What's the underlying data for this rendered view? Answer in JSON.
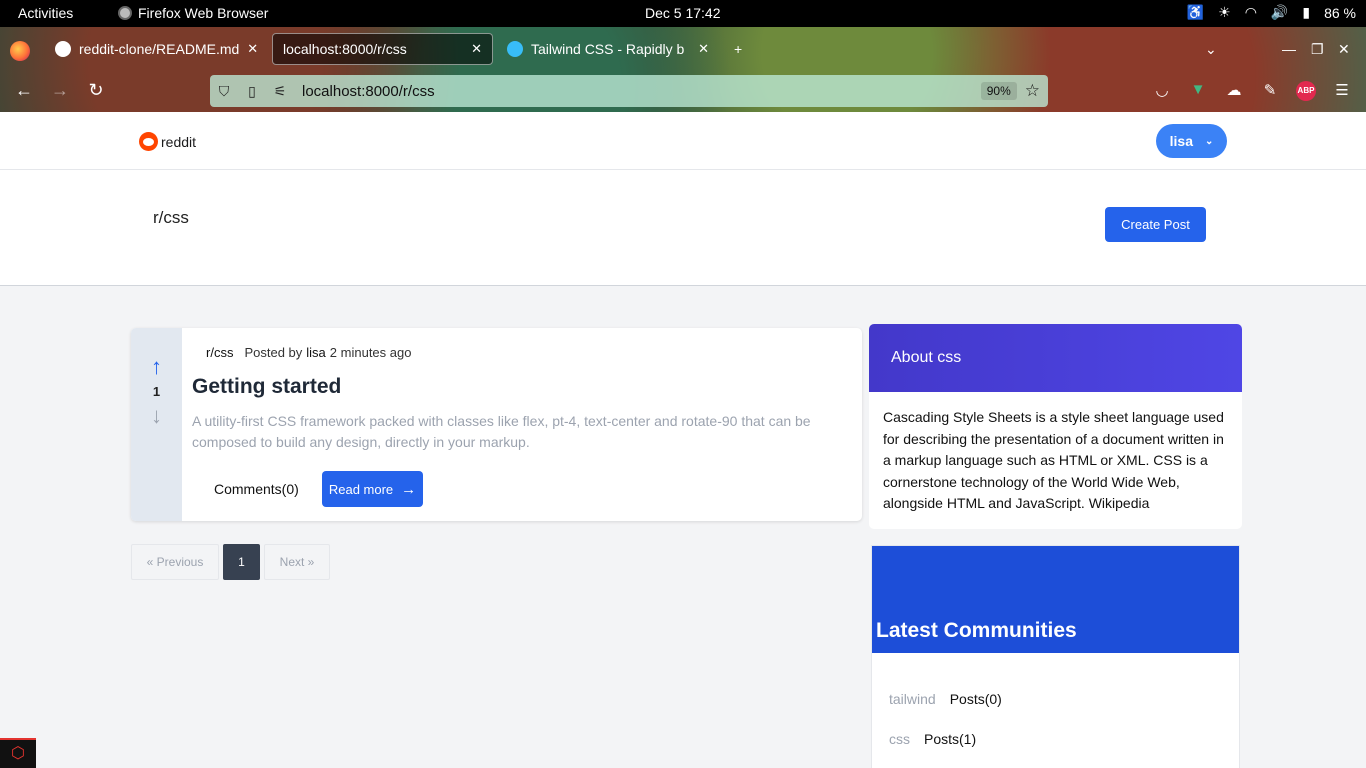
{
  "system": {
    "activities": "Activities",
    "app_name": "Firefox Web Browser",
    "clock": "Dec 5  17:42",
    "battery": "86 %"
  },
  "browser": {
    "tabs": [
      {
        "title": "reddit-clone/README.md",
        "active": false
      },
      {
        "title": "localhost:8000/r/css",
        "active": true
      },
      {
        "title": "Tailwind CSS - Rapidly b",
        "active": false
      }
    ],
    "url": "localhost:8000/r/css",
    "zoom": "90%"
  },
  "site": {
    "logo_text": "reddit",
    "user_name": "lisa"
  },
  "subreddit": {
    "title": "r/css",
    "create_post_label": "Create Post"
  },
  "post": {
    "votes": "1",
    "subreddit": "r/css",
    "posted_by": "Posted by",
    "author": "lisa",
    "time": "2 minutes ago",
    "title": "Getting started",
    "body": "A utility-first CSS framework packed with classes like flex, pt-4, text-center and rotate-90 that can be composed to build any design, directly in your markup.",
    "comments_label": "Comments(0)",
    "read_more_label": "Read more"
  },
  "pagination": {
    "prev": "« Previous",
    "current": "1",
    "next": "Next »"
  },
  "about": {
    "heading": "About css",
    "text": "Cascading Style Sheets is a style sheet language used for describing the presentation of a document written in a markup language such as HTML or XML. CSS is a cornerstone technology of the World Wide Web, alongside HTML and JavaScript. Wikipedia"
  },
  "latest": {
    "heading": "Latest Communities",
    "communities": [
      {
        "name": "tailwind",
        "posts": "Posts(0)"
      },
      {
        "name": "css",
        "posts": "Posts(1)"
      }
    ]
  },
  "colors": {
    "primary": "#2563eb",
    "about_header": "#4338ca",
    "latest_header": "#1d4ed8",
    "reddit_orange": "#ff4500"
  }
}
